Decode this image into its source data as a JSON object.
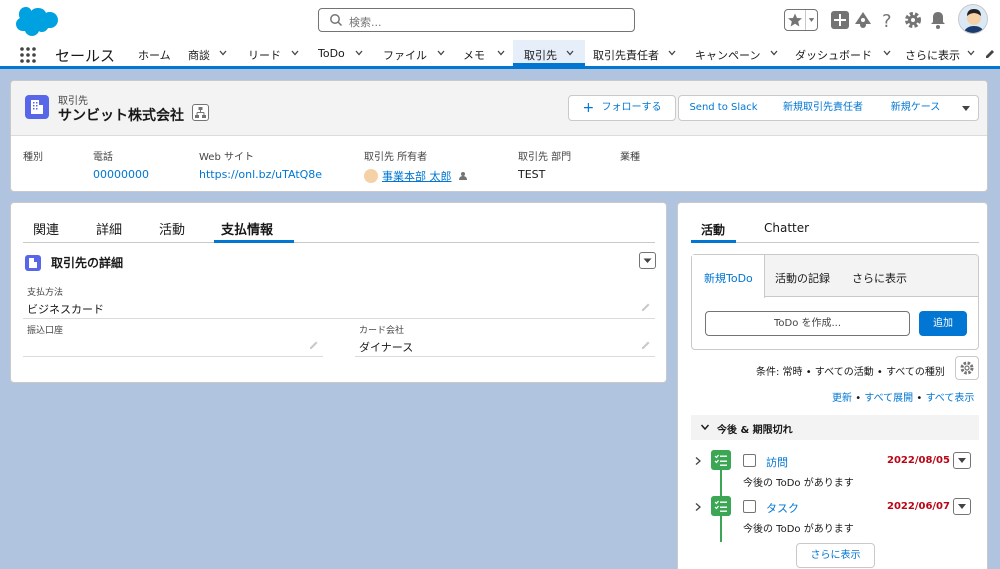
{
  "colors": {
    "brand": "#0176d3",
    "account_icon": "#5867e8",
    "task_icon": "#3ba755",
    "overdue": "#ba0517",
    "background": "#b0c4df"
  },
  "global_header": {
    "search_placeholder": "検索..."
  },
  "nav": {
    "app_name": "セールス",
    "items": [
      {
        "label": "ホーム",
        "dropdown": false
      },
      {
        "label": "商談",
        "dropdown": true
      },
      {
        "label": "リード",
        "dropdown": true
      },
      {
        "label": "ToDo",
        "dropdown": true
      },
      {
        "label": "ファイル",
        "dropdown": true
      },
      {
        "label": "メモ",
        "dropdown": true
      },
      {
        "label": "取引先",
        "dropdown": true,
        "active": true
      },
      {
        "label": "取引先責任者",
        "dropdown": true
      },
      {
        "label": "キャンペーン",
        "dropdown": true
      },
      {
        "label": "ダッシュボード",
        "dropdown": true
      },
      {
        "label": "さらに表示",
        "dropdown": true
      }
    ]
  },
  "record": {
    "object_label": "取引先",
    "name": "サンビット株式会社",
    "actions": {
      "follow": "フォローする",
      "slack": "Send to Slack",
      "new_contact": "新規取引先責任者",
      "new_case": "新規ケース"
    },
    "highlights": [
      {
        "label": "種別",
        "value": ""
      },
      {
        "label": "電話",
        "value": "00000000"
      },
      {
        "label": "Web サイト",
        "value": "https://onl.bz/uTAtQ8e"
      },
      {
        "label": "取引先 所有者",
        "value": "事業本部 太郎"
      },
      {
        "label": "取引先 部門",
        "value": "TEST"
      },
      {
        "label": "業種",
        "value": ""
      }
    ]
  },
  "detail": {
    "tabs": [
      "関連",
      "詳細",
      "活動",
      "支払情報"
    ],
    "active_tab": "支払情報",
    "section_title": "取引先の詳細",
    "fields": {
      "payment_method": {
        "label": "支払方法",
        "value": "ビジネスカード"
      },
      "bank_account": {
        "label": "振込口座",
        "value": ""
      },
      "card_company": {
        "label": "カード会社",
        "value": "ダイナース"
      }
    }
  },
  "activity": {
    "tabs": [
      "活動",
      "Chatter"
    ],
    "composer_tabs": [
      "新規ToDo",
      "活動の記録",
      "さらに表示"
    ],
    "todo_placeholder": "ToDo を作成...",
    "add_label": "追加",
    "filter": "条件: 常時 • すべての活動 • すべての種別",
    "links": {
      "refresh": "更新",
      "expand_all": "すべて展開",
      "show_all": "すべて表示"
    },
    "upcoming_header": "今後 & 期限切れ",
    "items": [
      {
        "title": "訪問",
        "date": "2022/08/05",
        "subtitle": "今後の ToDo があります"
      },
      {
        "title": "タスク",
        "date": "2022/06/07",
        "subtitle": "今後の ToDo があります"
      }
    ],
    "more_label": "さらに表示"
  }
}
